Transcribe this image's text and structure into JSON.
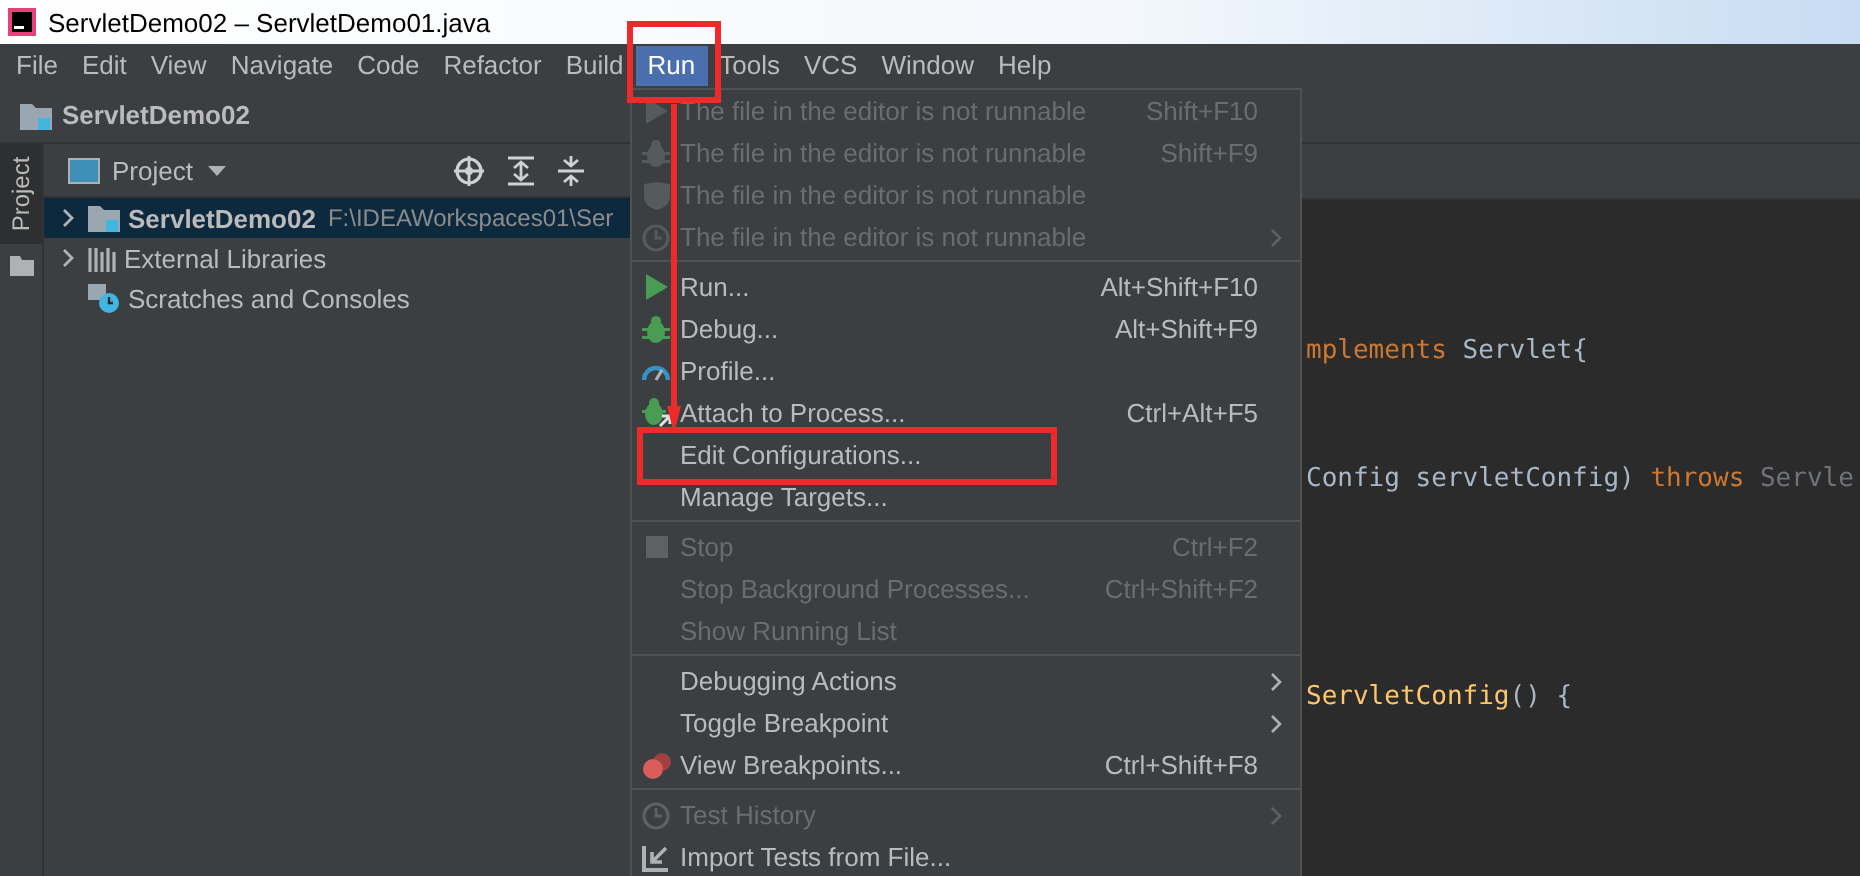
{
  "window": {
    "title": "ServletDemo02 – ServletDemo01.java"
  },
  "menu_bar": [
    {
      "label": "File",
      "selected": false
    },
    {
      "label": "Edit",
      "selected": false
    },
    {
      "label": "View",
      "selected": false
    },
    {
      "label": "Navigate",
      "selected": false
    },
    {
      "label": "Code",
      "selected": false
    },
    {
      "label": "Refactor",
      "selected": false
    },
    {
      "label": "Build",
      "selected": false
    },
    {
      "label": "Run",
      "selected": true
    },
    {
      "label": "Tools",
      "selected": false
    },
    {
      "label": "VCS",
      "selected": false
    },
    {
      "label": "Window",
      "selected": false
    },
    {
      "label": "Help",
      "selected": false
    }
  ],
  "nav_bar": {
    "project": "ServletDemo02"
  },
  "tool_stripe": [
    {
      "label": "Project",
      "selected": true
    }
  ],
  "project_panel": {
    "title": "Project",
    "tree": [
      {
        "label": "ServletDemo02",
        "path": "F:\\IDEAWorkspaces01\\Ser",
        "kind": "module",
        "expanded": false,
        "selected": true
      },
      {
        "label": "External Libraries",
        "kind": "libraries",
        "expanded": false,
        "selected": false
      },
      {
        "label": "Scratches and Consoles",
        "kind": "scratches",
        "selected": false
      }
    ]
  },
  "run_menu": {
    "groups": [
      [
        {
          "label": "The file in the editor is not runnable",
          "shortcut": "Shift+F10",
          "kind": "run",
          "disabled": true,
          "submenu": false
        },
        {
          "label": "The file in the editor is not runnable",
          "shortcut": "Shift+F9",
          "kind": "debug",
          "disabled": true,
          "submenu": false
        },
        {
          "label": "The file in the editor is not runnable",
          "kind": "coverage",
          "disabled": true,
          "submenu": false
        },
        {
          "label": "The file in the editor is not runnable",
          "kind": "profiler",
          "disabled": true,
          "submenu": true
        }
      ],
      [
        {
          "label": "Run...",
          "shortcut": "Alt+Shift+F10",
          "kind": "run",
          "disabled": false,
          "submenu": false
        },
        {
          "label": "Debug...",
          "shortcut": "Alt+Shift+F9",
          "kind": "debug",
          "disabled": false,
          "submenu": false
        },
        {
          "label": "Profile...",
          "kind": "profile",
          "disabled": false,
          "submenu": false
        },
        {
          "label": "Attach to Process...",
          "shortcut": "Ctrl+Alt+F5",
          "kind": "attach",
          "disabled": false,
          "submenu": false
        },
        {
          "label": "Edit Configurations...",
          "kind": "plain",
          "disabled": false,
          "submenu": false
        },
        {
          "label": "Manage Targets...",
          "kind": "plain",
          "disabled": false,
          "submenu": false
        }
      ],
      [
        {
          "label": "Stop",
          "shortcut": "Ctrl+F2",
          "kind": "stop",
          "disabled": true,
          "submenu": false
        },
        {
          "label": "Stop Background Processes...",
          "shortcut": "Ctrl+Shift+F2",
          "kind": "plain",
          "disabled": true,
          "submenu": false
        },
        {
          "label": "Show Running List",
          "kind": "plain",
          "disabled": true,
          "submenu": false
        }
      ],
      [
        {
          "label": "Debugging Actions",
          "kind": "plain",
          "disabled": false,
          "submenu": true
        },
        {
          "label": "Toggle Breakpoint",
          "kind": "plain",
          "disabled": false,
          "submenu": true
        },
        {
          "label": "View Breakpoints...",
          "shortcut": "Ctrl+Shift+F8",
          "kind": "breakpoints",
          "disabled": false,
          "submenu": false
        }
      ],
      [
        {
          "label": "Test History",
          "kind": "history",
          "disabled": true,
          "submenu": true
        },
        {
          "label": "Import Tests from File...",
          "kind": "import",
          "disabled": false,
          "submenu": false
        }
      ]
    ]
  },
  "editor": {
    "lines": [
      [
        {
          "text": "mplements",
          "kind": "keyword"
        },
        {
          "text": " Servlet{",
          "kind": "type"
        }
      ],
      [
        {
          "text": "Config servletConfig) ",
          "kind": "type"
        },
        {
          "text": "throws",
          "kind": "keyword"
        },
        {
          "text": " Servle",
          "kind": "dim"
        }
      ],
      [
        {
          "text": "ServletConfig",
          "kind": "method"
        },
        {
          "text": "() {",
          "kind": "type"
        }
      ]
    ]
  }
}
